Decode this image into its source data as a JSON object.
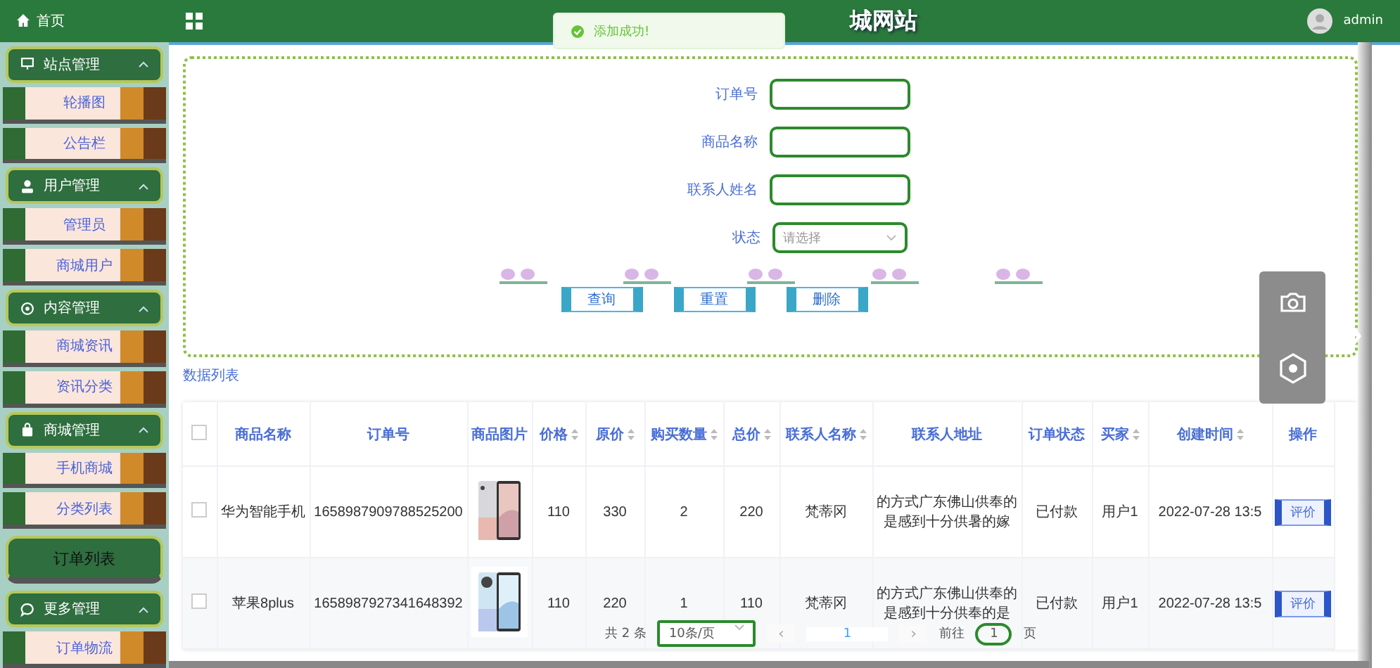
{
  "sidebar": {
    "home": {
      "label": "首页"
    },
    "groups": [
      {
        "label": "站点管理",
        "expanded": true,
        "items": [
          {
            "label": "轮播图",
            "selected": false
          },
          {
            "label": "公告栏",
            "selected": false
          }
        ]
      },
      {
        "label": "用户管理",
        "expanded": true,
        "items": [
          {
            "label": "管理员",
            "selected": false
          },
          {
            "label": "商城用户",
            "selected": false
          }
        ]
      },
      {
        "label": "内容管理",
        "expanded": true,
        "items": [
          {
            "label": "商城资讯",
            "selected": false
          },
          {
            "label": "资讯分类",
            "selected": false
          }
        ]
      },
      {
        "label": "商城管理",
        "expanded": true,
        "items": [
          {
            "label": "手机商城",
            "selected": false
          },
          {
            "label": "分类列表",
            "selected": false
          },
          {
            "label": "订单列表",
            "selected": true
          }
        ]
      },
      {
        "label": "更多管理",
        "expanded": true,
        "items": [
          {
            "label": "订单物流",
            "selected": false
          }
        ]
      }
    ]
  },
  "header": {
    "title": "城网站",
    "user": "admin"
  },
  "toast": {
    "message": "添加成功!"
  },
  "search_form": {
    "fields": [
      {
        "kind": "input",
        "label": "订单号"
      },
      {
        "kind": "input",
        "label": "商品名称"
      },
      {
        "kind": "input",
        "label": "联系人姓名"
      },
      {
        "kind": "select",
        "label": "状态",
        "placeholder": "请选择"
      }
    ],
    "buttons": [
      "查询",
      "重置",
      "删除"
    ]
  },
  "data_list_link": "数据列表",
  "table": {
    "select_all_checked": false,
    "columns": [
      {
        "label": "商品名称",
        "sortable": false
      },
      {
        "label": "订单号",
        "sortable": false
      },
      {
        "label": "商品图片",
        "sortable": false
      },
      {
        "label": "价格",
        "sortable": true
      },
      {
        "label": "原价",
        "sortable": true
      },
      {
        "label": "购买数量",
        "sortable": true
      },
      {
        "label": "总价",
        "sortable": true
      },
      {
        "label": "联系人名称",
        "sortable": true
      },
      {
        "label": "联系人地址",
        "sortable": false
      },
      {
        "label": "订单状态",
        "sortable": false
      },
      {
        "label": "买家",
        "sortable": true
      },
      {
        "label": "创建时间",
        "sortable": true
      },
      {
        "label": "操作",
        "sortable": false
      }
    ],
    "rows": [
      {
        "checked": false,
        "cells": [
          "华为智能手机",
          "1658987909788525200",
          {
            "kind": "picture"
          },
          "110",
          "330",
          "2",
          "220",
          "梵蒂冈",
          "的方式广东佛山供奉的是感到十分供暑的嫁",
          "已付款",
          "用户1",
          "2022-07-28 13:5"
        ],
        "action": "评价"
      },
      {
        "checked": false,
        "cells": [
          "苹果8plus",
          "1658987927341648392",
          {
            "kind": "picture"
          },
          "110",
          "220",
          "1",
          "110",
          "梵蒂冈",
          "的方式广东佛山供奉的是感到十分供奉的是",
          "已付款",
          "用户1",
          "2022-07-28 13:5"
        ],
        "action": "评价"
      }
    ]
  },
  "pagination": {
    "total": "共 2 条",
    "page_size": "10条/页",
    "prev": "‹",
    "pages": [
      {
        "label": "1",
        "selected": true
      }
    ],
    "next": "›",
    "goto_label": "前往",
    "goto_value": "1",
    "goto_suffix": "页"
  }
}
